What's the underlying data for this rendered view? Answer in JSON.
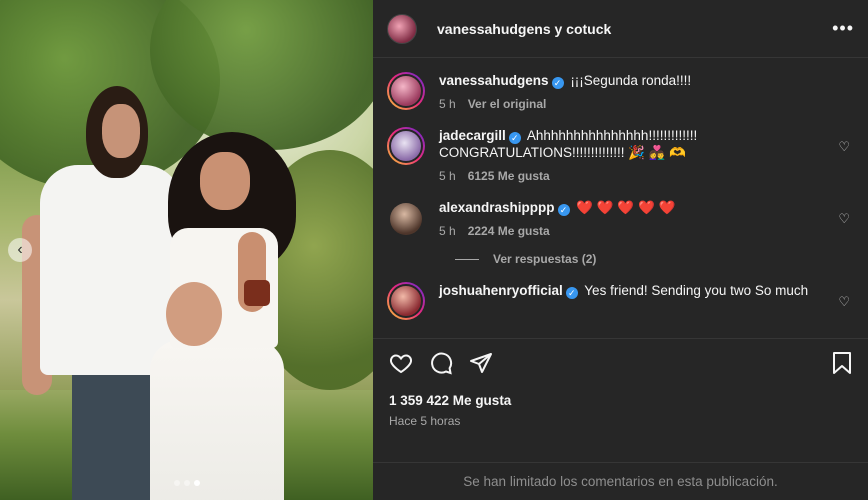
{
  "post": {
    "header_title": "vanessahudgens y cotuck",
    "more_label": "•••",
    "carousel": {
      "prev_label": "‹",
      "dot_count": 3,
      "active_dot": 2
    }
  },
  "comments": [
    {
      "user": "vanessahudgens",
      "verified": true,
      "text": "¡¡¡Segunda ronda!!!!",
      "time": "5 h",
      "secondary": "Ver el original",
      "secondary_type": "original",
      "story_ring": true,
      "avatar": "av-v"
    },
    {
      "user": "jadecargill",
      "verified": true,
      "text": "Ahhhhhhhhhhhhhhh!!!!!!!!!!!!! CONGRATULATIONS!!!!!!!!!!!!!! 🎉 👩‍❤️‍👨 🫶",
      "time": "5 h",
      "secondary": "6125 Me gusta",
      "secondary_type": "likes",
      "story_ring": true,
      "avatar": "av-j"
    },
    {
      "user": "alexandrashipppp",
      "verified": true,
      "text": "❤️ ❤️ ❤️ ❤️ ❤️",
      "time": "5 h",
      "secondary": "2224 Me gusta",
      "secondary_type": "likes",
      "story_ring": false,
      "avatar": "av-a"
    },
    {
      "user": "joshuahenryofficial",
      "verified": true,
      "text": "Yes friend! Sending you two So much",
      "time": "",
      "secondary": "",
      "secondary_type": "",
      "story_ring": true,
      "avatar": "av-jo"
    }
  ],
  "view_replies": "Ver respuestas (2)",
  "actions": {
    "icons": [
      "heart-icon",
      "comment-icon",
      "share-icon",
      "bookmark-icon"
    ]
  },
  "likes_total": "1 359 422 Me gusta",
  "posted_ago": "Hace 5 horas",
  "comments_limited": "Se han limitado los comentarios en esta publicación."
}
